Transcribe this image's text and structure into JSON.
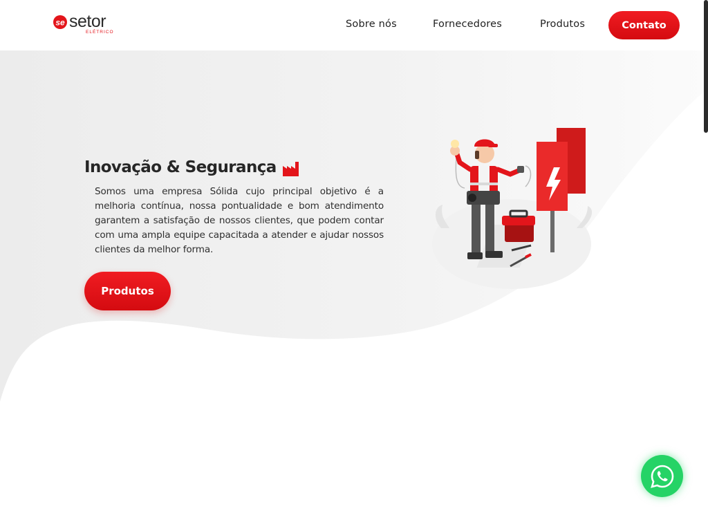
{
  "brand": {
    "logo_mark": "se",
    "logo_name": "setor",
    "logo_sub": "ELÉTRICO",
    "accent_color": "#e3151b"
  },
  "nav": {
    "items": [
      {
        "label": "Sobre nós"
      },
      {
        "label": "Fornecedores"
      },
      {
        "label": "Produtos"
      }
    ],
    "cta_label": "Contato"
  },
  "hero": {
    "title": "Inovação & Segurança",
    "title_icon": "factory-icon",
    "text": "Somos uma empresa Sólida cujo principal objetivo é a melhoria contínua, nossa pontualidade e bom atendimento garantem a satisfação de nossos clientes, que podem contar com uma ampla equipe capacitada a atender e ajudar nossos clientes da melhor forma.",
    "button_label": "Produtos",
    "illustration": "electrician-illustration"
  },
  "floating": {
    "whatsapp_icon": "whatsapp-icon",
    "whatsapp_color": "#25d366"
  }
}
